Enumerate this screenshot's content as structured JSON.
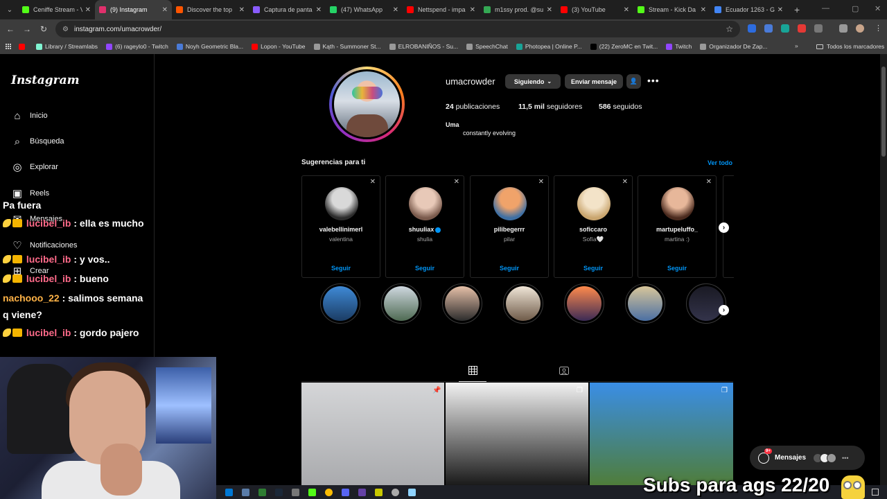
{
  "browser": {
    "tabs": [
      {
        "title": "Ceniffe Stream - Vi",
        "color": "#53fc18"
      },
      {
        "title": "(9) Instagram",
        "color": "#e1306c",
        "active": true
      },
      {
        "title": "Discover the top",
        "color": "#ff5500"
      },
      {
        "title": "Captura de panta",
        "color": "#8a5cff"
      },
      {
        "title": "(47) WhatsApp",
        "color": "#25d366"
      },
      {
        "title": "Nettspend - impa",
        "color": "#ff0000"
      },
      {
        "title": "m1ssy prod. @su",
        "color": "#34a853"
      },
      {
        "title": "(3) YouTube",
        "color": "#ff0000"
      },
      {
        "title": "Stream - Kick Da",
        "color": "#53fc18"
      },
      {
        "title": "Ecuador 1263 - G",
        "color": "#4285f4"
      }
    ],
    "url": "instagram.com/umacrowder/",
    "bookmarks": [
      {
        "label": "",
        "color": "#ff0000"
      },
      {
        "label": "Library / Streamlabs",
        "color": "#80f5d2"
      },
      {
        "label": "(6) rageylo0 - Twitch",
        "color": "#9146ff"
      },
      {
        "label": "Noyh Geometric Bla...",
        "color": "#4a7bd8"
      },
      {
        "label": "Lopon - YouTube",
        "color": "#ff0000"
      },
      {
        "label": "Kąth - Summoner St...",
        "color": "#999999"
      },
      {
        "label": "ELROBANIÑOS - Su...",
        "color": "#999999"
      },
      {
        "label": "SpeechChat",
        "color": "#999999"
      },
      {
        "label": "Photopea | Online P...",
        "color": "#18a497"
      },
      {
        "label": "(22) ZeroMC en Twit...",
        "color": "#000000"
      },
      {
        "label": "Twitch",
        "color": "#9146ff"
      },
      {
        "label": "Organizador De Zap...",
        "color": "#999999"
      }
    ],
    "all_bookmarks": "Todos los marcadores"
  },
  "instagram": {
    "logo": "Instagram",
    "nav": [
      {
        "label": "Inicio",
        "icon": "home-icon"
      },
      {
        "label": "Búsqueda",
        "icon": "search-icon"
      },
      {
        "label": "Explorar",
        "icon": "compass-icon"
      },
      {
        "label": "Reels",
        "icon": "reels-icon"
      },
      {
        "label": "Mensajes",
        "icon": "messenger-icon"
      },
      {
        "label": "Notificaciones",
        "icon": "heart-icon"
      },
      {
        "label": "Crear",
        "icon": "plus-square-icon"
      }
    ],
    "profile": {
      "username": "umacrowder",
      "following_btn": "Siguiendo",
      "message_btn": "Enviar mensaje",
      "posts_count": "24",
      "posts_label": "publicaciones",
      "followers_count": "11,5 mil",
      "followers_label": "seguidores",
      "following_count": "586",
      "following_label": "seguidos",
      "full_name": "Uma",
      "bio": "constantly evolving"
    },
    "suggestions": {
      "title": "Sugerencias para ti",
      "see_all": "Ver todo",
      "follow_label": "Seguir",
      "cards": [
        {
          "username": "valebellinimerl",
          "name": "valentina",
          "colors": [
            "#d9d9d9",
            "#2b2b2b"
          ]
        },
        {
          "username": "shuuliax",
          "name": "shulia",
          "verified": true,
          "colors": [
            "#e8c9b8",
            "#7a5a4c"
          ]
        },
        {
          "username": "pilibegerrr",
          "name": "pilar",
          "colors": [
            "#f0a36a",
            "#3e6fa3"
          ]
        },
        {
          "username": "soficcaro",
          "name": "Sofía🤍",
          "colors": [
            "#f3e3c8",
            "#c9a56e"
          ]
        },
        {
          "username": "martupeluffo_",
          "name": "martina :)",
          "colors": [
            "#e7b79a",
            "#4a2a1e"
          ]
        }
      ]
    },
    "highlights": [
      {
        "colors": [
          "#3f8ad6",
          "#1b3c63"
        ]
      },
      {
        "colors": [
          "#cfd8e0",
          "#4e6a52"
        ]
      },
      {
        "colors": [
          "#e6c0a8",
          "#2b2b2b"
        ]
      },
      {
        "colors": [
          "#f0e6d8",
          "#6e5a48"
        ]
      },
      {
        "colors": [
          "#ff8a4c",
          "#3a2a55"
        ]
      },
      {
        "colors": [
          "#d8c69a",
          "#4a6fa3"
        ]
      },
      {
        "colors": [
          "#1a1a24",
          "#33334a"
        ]
      }
    ],
    "posts": [
      {
        "colors": [
          "#d5d6d8",
          "#a9aaad"
        ],
        "badge": "pin-icon"
      },
      {
        "colors": [
          "#f2f2f2",
          "#1a1a1a"
        ],
        "badge": "carousel-icon"
      },
      {
        "colors": [
          "#3a8ee6",
          "#4f7d3a"
        ],
        "badge": "carousel-icon"
      }
    ],
    "messages_pill": {
      "label": "Mensajes",
      "badge": "9+"
    }
  },
  "stream_overlay": {
    "chat": [
      {
        "text": "Pa fuera"
      },
      {
        "user": "lucibel_ib",
        "text": ": ella es mucho",
        "emotes": true
      },
      {
        "user": "lucibel_ib",
        "text": ": y vos..",
        "emotes": true
      },
      {
        "user": "lucibel_ib",
        "text": ": bueno",
        "emotes": true
      },
      {
        "user": "nachooo_22",
        "text": ": salimos semana q viene?"
      },
      {
        "user": "lucibel_ib",
        "text": ": gordo pajero",
        "emotes": true
      }
    ],
    "subs_goal": "Subs para ags 22/20"
  }
}
